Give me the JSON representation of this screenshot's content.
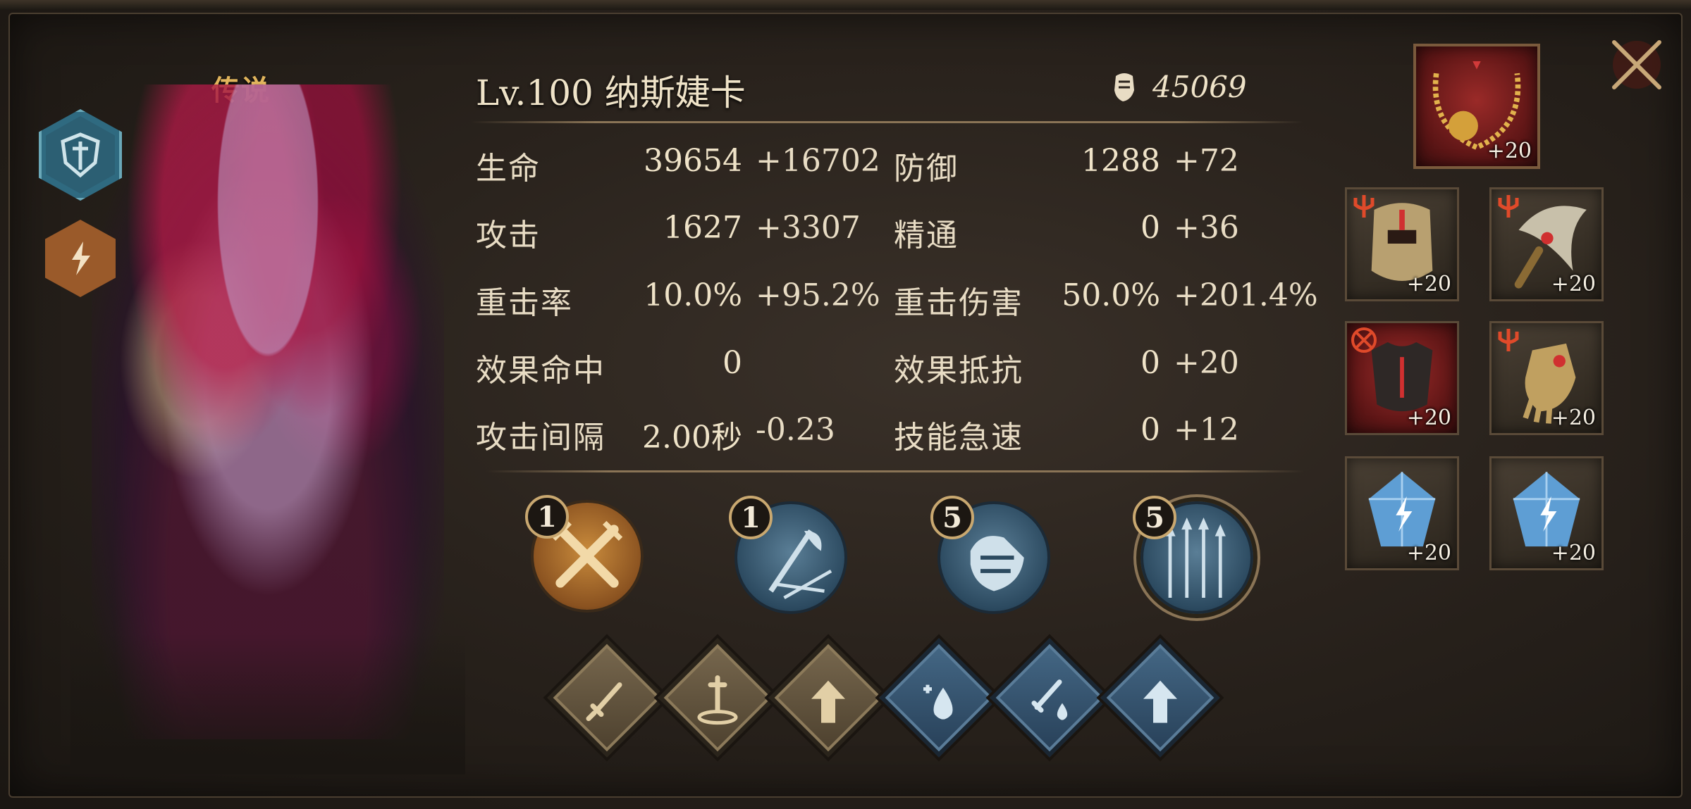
{
  "hero": {
    "rarity": "传说",
    "level_name": "Lv.100  纳斯婕卡",
    "power": "45069",
    "role_badges": [
      "shield-class-icon",
      "lightning-element-icon"
    ]
  },
  "stats": [
    {
      "label": "生命",
      "base": "39654",
      "bonus": "+16702"
    },
    {
      "label": "防御",
      "base": "1288",
      "bonus": "+72"
    },
    {
      "label": "攻击",
      "base": "1627",
      "bonus": "+3307"
    },
    {
      "label": "精通",
      "base": "0",
      "bonus": "+36"
    },
    {
      "label": "重击率",
      "base": "10.0%",
      "bonus": "+95.2%"
    },
    {
      "label": "重击伤害",
      "base": "50.0%",
      "bonus": "+201.4%"
    },
    {
      "label": "效果命中",
      "base": "0",
      "bonus": ""
    },
    {
      "label": "效果抵抗",
      "base": "0",
      "bonus": "+20"
    },
    {
      "label": "攻击间隔",
      "base": "2.00秒",
      "bonus": "-0.23"
    },
    {
      "label": "技能急速",
      "base": "0",
      "bonus": "+12"
    }
  ],
  "skills": [
    {
      "level": "1",
      "icon": "crossed-swords-icon"
    },
    {
      "level": "1",
      "icon": "feather-arrow-icon"
    },
    {
      "level": "5",
      "icon": "armored-fist-icon"
    },
    {
      "level": "5",
      "icon": "arrow-volley-icon"
    }
  ],
  "runes": [
    {
      "icon": "sword-icon"
    },
    {
      "icon": "sword-ground-icon"
    },
    {
      "icon": "upgrade-arrow-icon"
    },
    {
      "icon": "water-drop-plus-icon"
    },
    {
      "icon": "sword-drop-icon"
    },
    {
      "icon": "upgrade-arrow-icon"
    }
  ],
  "equipment": {
    "necklace": {
      "enhance": "+20"
    },
    "helmet": {
      "enhance": "+20"
    },
    "weapon": {
      "enhance": "+20"
    },
    "armor": {
      "enhance": "+20"
    },
    "gloves": {
      "enhance": "+20"
    },
    "gem_left": {
      "enhance": "+20"
    },
    "gem_right": {
      "enhance": "+20"
    }
  },
  "colors": {
    "bonus": "#d8a94e",
    "text": "#e8dcc4",
    "rarity": "#e0b45c"
  }
}
